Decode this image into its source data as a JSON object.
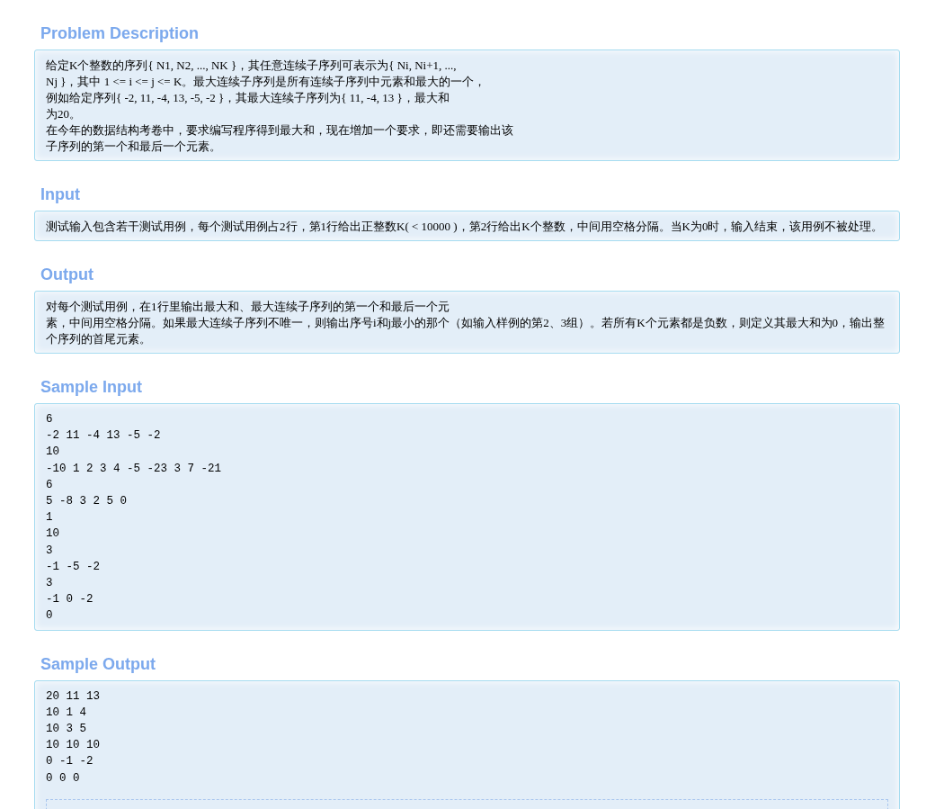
{
  "sections": [
    {
      "title": "Problem Description",
      "kind": "text",
      "lines": [
        "给定K个整数的序列{ N1, N2, ..., NK }，其任意连续子序列可表示为{ Ni, Ni+1, ...,",
        "Nj }，其中 1 <= i <= j <= K。最大连续子序列是所有连续子序列中元素和最大的一个，",
        "例如给定序列{ -2, 11, -4, 13, -5, -2 }，其最大连续子序列为{ 11, -4, 13 }，最大和",
        "为20。",
        "在今年的数据结构考卷中，要求编写程序得到最大和，现在增加一个要求，即还需要输出该",
        "子序列的第一个和最后一个元素。"
      ]
    },
    {
      "title": "Input",
      "kind": "text",
      "lines": [
        "测试输入包含若干测试用例，每个测试用例占2行，第1行给出正整数K( < 10000 )，第2行给出K个整数，中间用空格分隔。当K为0时，输入结束，该用例不被处理。"
      ]
    },
    {
      "title": "Output",
      "kind": "text",
      "lines": [
        "对每个测试用例，在1行里输出最大和、最大连续子序列的第一个和最后一个元",
        "素，中间用空格分隔。如果最大连续子序列不唯一，则输出序号i和j最小的那个（如输入样例的第2、3组）。若所有K个元素都是负数，则定义其最大和为0，输出整个序列的首尾元素。"
      ]
    },
    {
      "title": "Sample Input",
      "kind": "code",
      "lines": [
        "6",
        "-2 11 -4 13 -5 -2",
        "10",
        "-10 1 2 3 4 -5 -23 3 7 -21",
        "6",
        "5 -8 3 2 5 0",
        "1",
        "10",
        "3",
        "-1 -5 -2",
        "3",
        "-1 0 -2",
        "0"
      ]
    },
    {
      "title": "Sample Output",
      "kind": "code",
      "lines": [
        "20 11 13",
        "10 1 4",
        "10 3 5",
        "10 10 10",
        "0 -1 -2",
        "0 0 0"
      ]
    }
  ]
}
